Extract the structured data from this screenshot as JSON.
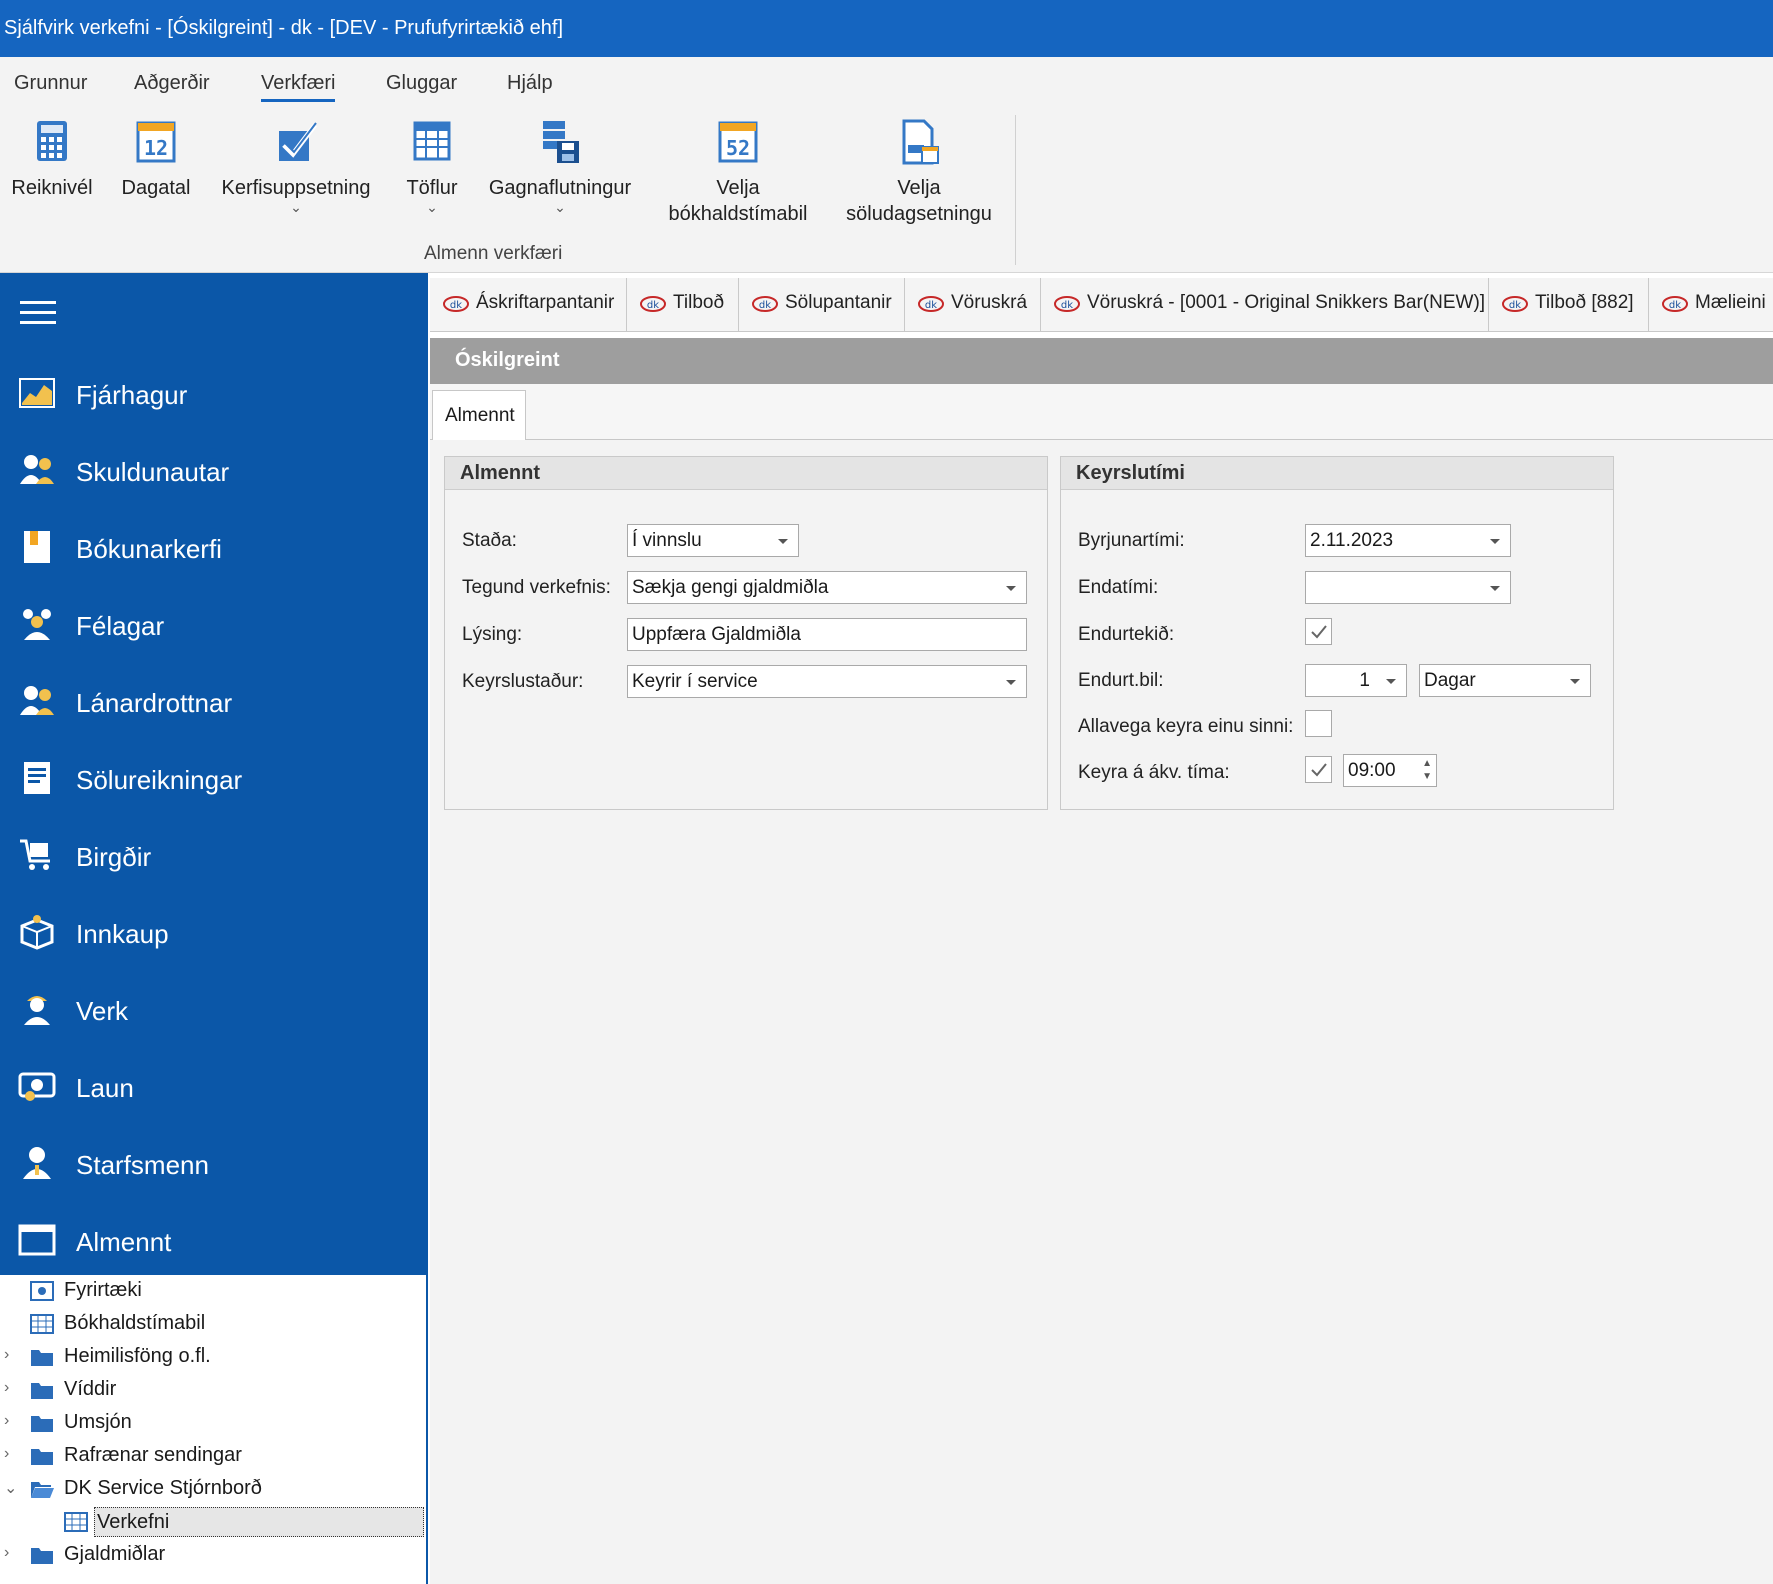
{
  "window": {
    "title": "Sjálfvirk verkefni - [Óskilgreint] -  dk - [DEV - Prufufyrirtækið ehf]"
  },
  "menu": [
    "Grunnur",
    "Aðgerðir",
    "Verkfæri",
    "Gluggar",
    "Hjálp"
  ],
  "ribbon": {
    "buttons": [
      {
        "line1": "Reiknivél",
        "line2": ""
      },
      {
        "line1": "Dagatal",
        "line2": ""
      },
      {
        "line1": "Kerfisuppsetning",
        "line2": ""
      },
      {
        "line1": "Töflur",
        "line2": ""
      },
      {
        "line1": "Gagnaflutningur",
        "line2": ""
      },
      {
        "line1": "Velja",
        "line2": "bókhaldstímabil"
      },
      {
        "line1": "Velja",
        "line2": "söludagsetningu"
      }
    ],
    "calendar_day": "12",
    "calendar_week": "52",
    "group_label": "Almenn verkfæri"
  },
  "sidebar": {
    "items": [
      {
        "label": "Fjárhagur"
      },
      {
        "label": "Skuldunautar"
      },
      {
        "label": "Bókunarkerfi"
      },
      {
        "label": "Félagar"
      },
      {
        "label": "Lánardrottnar"
      },
      {
        "label": "Sölureikningar"
      },
      {
        "label": "Birgðir"
      },
      {
        "label": "Innkaup"
      },
      {
        "label": "Verk"
      },
      {
        "label": "Laun"
      },
      {
        "label": "Starfsmenn"
      },
      {
        "label": "Almennt"
      }
    ]
  },
  "tree": {
    "nodes": [
      {
        "label": "Fyrirtæki"
      },
      {
        "label": "Bókhaldstímabil"
      },
      {
        "label": "Heimilisföng o.fl."
      },
      {
        "label": "Víddir"
      },
      {
        "label": "Umsjón"
      },
      {
        "label": "Rafrænar sendingar"
      },
      {
        "label": "DK Service Stjórnborð"
      },
      {
        "label": "Verkefni"
      },
      {
        "label": "Gjaldmiðlar"
      }
    ]
  },
  "doc_tabs": [
    {
      "label": "Áskriftarpantanir"
    },
    {
      "label": "Tilboð"
    },
    {
      "label": "Sölupantanir"
    },
    {
      "label": "Vöruskrá"
    },
    {
      "label": "Vöruskrá - [0001 - Original Snikkers Bar(NEW)]"
    },
    {
      "label": "Tilboð [882]"
    },
    {
      "label": "Mælieini"
    }
  ],
  "form": {
    "header": "Óskilgreint",
    "tab": "Almennt",
    "general": {
      "title": "Almennt",
      "status_label": "Staða:",
      "status_value": "Í vinnslu",
      "type_label": "Tegund verkefnis:",
      "type_value": "Sækja gengi gjaldmiðla",
      "desc_label": "Lýsing:",
      "desc_value": "Uppfæra Gjaldmiðla",
      "location_label": "Keyrslustaður:",
      "location_value": "Keyrir í service"
    },
    "runtime": {
      "title": "Keyrslutími",
      "start_label": "Byrjunartími:",
      "start_value": "2.11.2023",
      "end_label": "Endatími:",
      "end_value": " .  .       :  :",
      "repeat_label": "Endurtekið:",
      "repeat_checked": true,
      "interval_label": "Endurt.bil:",
      "interval_value": "1",
      "interval_unit": "Dagar",
      "runonce_label": "Allavega keyra einu sinni:",
      "runonce_checked": false,
      "runat_label": "Keyra á ákv. tíma:",
      "runat_checked": true,
      "runat_time": "09:00"
    }
  }
}
